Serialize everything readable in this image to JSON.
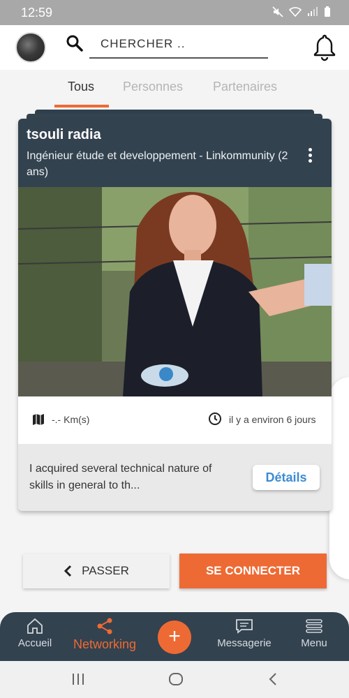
{
  "status_bar": {
    "time": "12:59"
  },
  "search": {
    "placeholder": "CHERCHER .."
  },
  "tabs": [
    {
      "label": "Tous",
      "active": true
    },
    {
      "label": "Personnes",
      "active": false
    },
    {
      "label": "Partenaires",
      "active": false
    }
  ],
  "card": {
    "name": "tsouli radia",
    "role": "Ingénieur étude et developpement - Linkommunity (2 ans)",
    "distance": "-.- Km(s)",
    "time_ago": "il y a environ 6 jours",
    "summary": "I acquired several technical nature of skills in general to th...",
    "details_label": "Détails"
  },
  "actions": {
    "pass_label": "PASSER",
    "connect_label": "SE CONNECTER"
  },
  "bottom_nav": [
    {
      "label": "Accueil",
      "icon": "home-icon"
    },
    {
      "label": "Networking",
      "icon": "share-icon",
      "active": true
    },
    {
      "label": "Messagerie",
      "icon": "message-icon"
    },
    {
      "label": "Menu",
      "icon": "menu-icon"
    }
  ],
  "colors": {
    "accent": "#ee6a34",
    "navy": "#33424f",
    "link": "#3d8bd4"
  }
}
